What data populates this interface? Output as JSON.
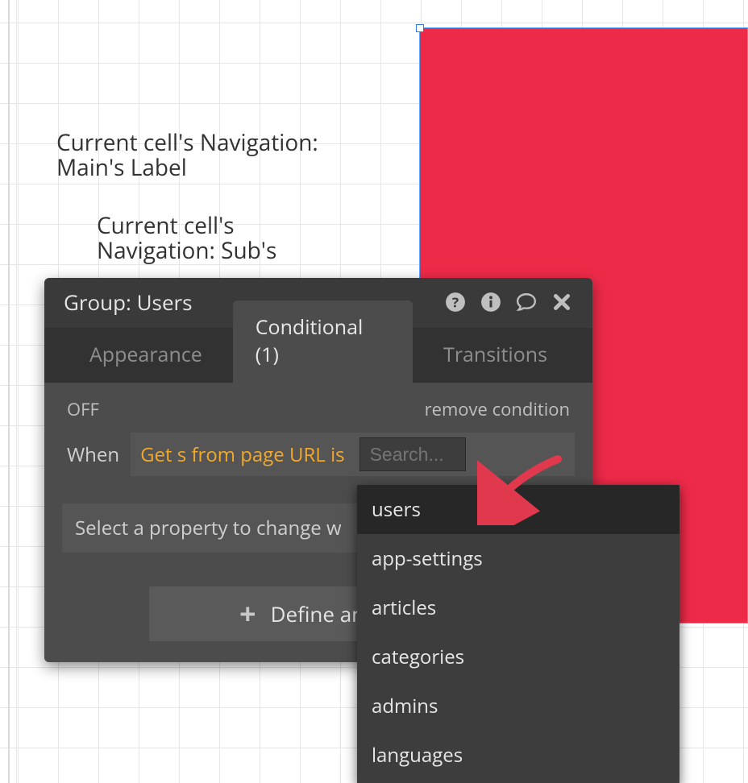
{
  "canvas": {
    "cellText1": "Current cell's Navigation: Main's Label",
    "cellText2": "Current cell's Navigation: Sub's"
  },
  "panel": {
    "title": "Group: Users",
    "tabs": {
      "appearance": "Appearance",
      "conditional": "Conditional (1)",
      "transitions": "Transitions"
    },
    "offLabel": "OFF",
    "removeLabel": "remove condition",
    "whenLabel": "When",
    "expression": "Get s from page URL is",
    "searchPlaceholder": "Search...",
    "selectPropLabel": "Select a property to change w",
    "defineBtnLabel": "Define anoth"
  },
  "dropdown": {
    "items": [
      "users",
      "app-settings",
      "articles",
      "categories",
      "admins",
      "languages"
    ]
  }
}
